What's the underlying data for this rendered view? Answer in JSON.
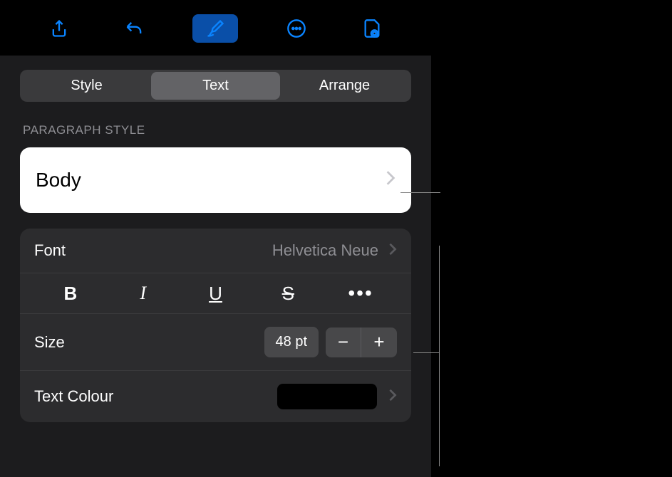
{
  "toolbar": {
    "share": "share",
    "undo": "undo",
    "format": "format",
    "more": "more",
    "document": "document"
  },
  "segmented": {
    "style": "Style",
    "text": "Text",
    "arrange": "Arrange"
  },
  "paragraph": {
    "header": "Paragraph Style",
    "current": "Body"
  },
  "font": {
    "label": "Font",
    "value": "Helvetica Neue"
  },
  "formatting": {
    "bold": "B",
    "italic": "I",
    "underline": "U",
    "strike": "S",
    "more": "•••"
  },
  "size": {
    "label": "Size",
    "value": "48 pt",
    "minus": "−",
    "plus": "+"
  },
  "color": {
    "label": "Text Colour",
    "value": "#000000"
  }
}
